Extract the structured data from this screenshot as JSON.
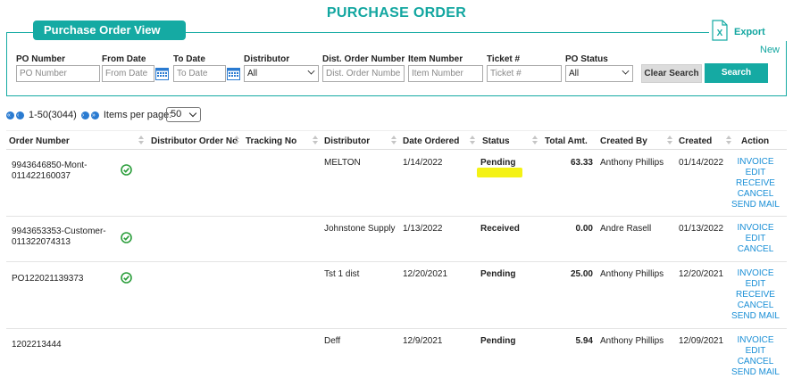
{
  "page": {
    "title": "PURCHASE ORDER"
  },
  "filter": {
    "tab_label": "Purchase Order View",
    "export_label": "Export",
    "new_label": "New",
    "fields": [
      {
        "label": "PO Number",
        "placeholder": "PO Number"
      },
      {
        "label": "From Date",
        "placeholder": "From Date"
      },
      {
        "label": "To Date",
        "placeholder": "To Date"
      },
      {
        "label": "Distributor",
        "value": "All"
      },
      {
        "label": "Dist. Order Number",
        "placeholder": "Dist. Order Number"
      },
      {
        "label": "Item Number",
        "placeholder": "Item Number"
      },
      {
        "label": "Ticket #",
        "placeholder": "Ticket #"
      },
      {
        "label": "PO Status",
        "value": "All"
      }
    ],
    "clear_label": "Clear Search",
    "search_label": "Search"
  },
  "pager": {
    "range_text": "1-50(3044)",
    "items_label": "Items per page:",
    "items_value": "50"
  },
  "table": {
    "headers": [
      "Order Number",
      "Distributor Order No",
      "Tracking No",
      "Distributor",
      "Date Ordered",
      "Status",
      "Total Amt.",
      "Created By",
      "Created",
      "Action"
    ],
    "rows": [
      {
        "order_line1": "9943646850-Mont-",
        "order_line2": "011422160037",
        "checked": true,
        "distributor": "MELTON",
        "date_ordered": "1/14/2022",
        "status": "Pending",
        "total": "63.33",
        "created_by": "Anthony Phillips",
        "created": "01/14/2022",
        "actions": [
          "INVOICE",
          "EDIT",
          "RECEIVE",
          "CANCEL",
          "SEND MAIL"
        ]
      },
      {
        "order_line1": "9943653353-Customer-",
        "order_line2": "011322074313",
        "checked": true,
        "distributor": "Johnstone Supply",
        "date_ordered": "1/13/2022",
        "status": "Received",
        "total": "0.00",
        "created_by": "Andre Rasell",
        "created": "01/13/2022",
        "actions": [
          "INVOICE",
          "EDIT",
          "CANCEL"
        ]
      },
      {
        "order_line1": "PO122021139373",
        "order_line2": "",
        "checked": true,
        "distributor": "Tst 1 dist",
        "date_ordered": "12/20/2021",
        "status": "Pending",
        "total": "25.00",
        "created_by": "Anthony Phillips",
        "created": "12/20/2021",
        "actions": [
          "INVOICE",
          "EDIT",
          "RECEIVE",
          "CANCEL",
          "SEND MAIL"
        ]
      },
      {
        "order_line1": "1202213444",
        "order_line2": "",
        "checked": false,
        "distributor": "Deff",
        "date_ordered": "12/9/2021",
        "status": "Pending",
        "total": "5.94",
        "created_by": "Anthony Phillips",
        "created": "12/09/2021",
        "actions": [
          "INVOICE",
          "EDIT",
          "CANCEL",
          "SEND MAIL"
        ]
      }
    ]
  },
  "colors": {
    "accent": "#15aaa3",
    "link": "#1a8fd6",
    "highlight": "#f4f215"
  }
}
